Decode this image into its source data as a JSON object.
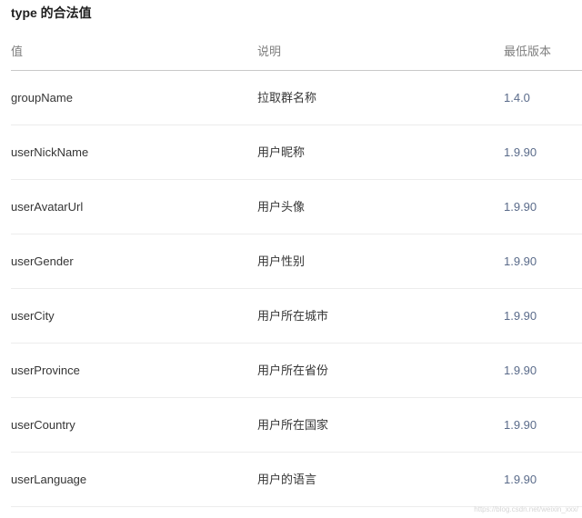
{
  "title": "type 的合法值",
  "table": {
    "headers": {
      "value": "值",
      "description": "说明",
      "min_version": "最低版本"
    },
    "rows": [
      {
        "value": "groupName",
        "description": "拉取群名称",
        "min_version": "1.4.0"
      },
      {
        "value": "userNickName",
        "description": "用户昵称",
        "min_version": "1.9.90"
      },
      {
        "value": "userAvatarUrl",
        "description": "用户头像",
        "min_version": "1.9.90"
      },
      {
        "value": "userGender",
        "description": "用户性别",
        "min_version": "1.9.90"
      },
      {
        "value": "userCity",
        "description": "用户所在城市",
        "min_version": "1.9.90"
      },
      {
        "value": "userProvince",
        "description": "用户所在省份",
        "min_version": "1.9.90"
      },
      {
        "value": "userCountry",
        "description": "用户所在国家",
        "min_version": "1.9.90"
      },
      {
        "value": "userLanguage",
        "description": "用户的语言",
        "min_version": "1.9.90"
      }
    ]
  },
  "watermark": "https://blog.csdn.net/weixin_xxx/"
}
